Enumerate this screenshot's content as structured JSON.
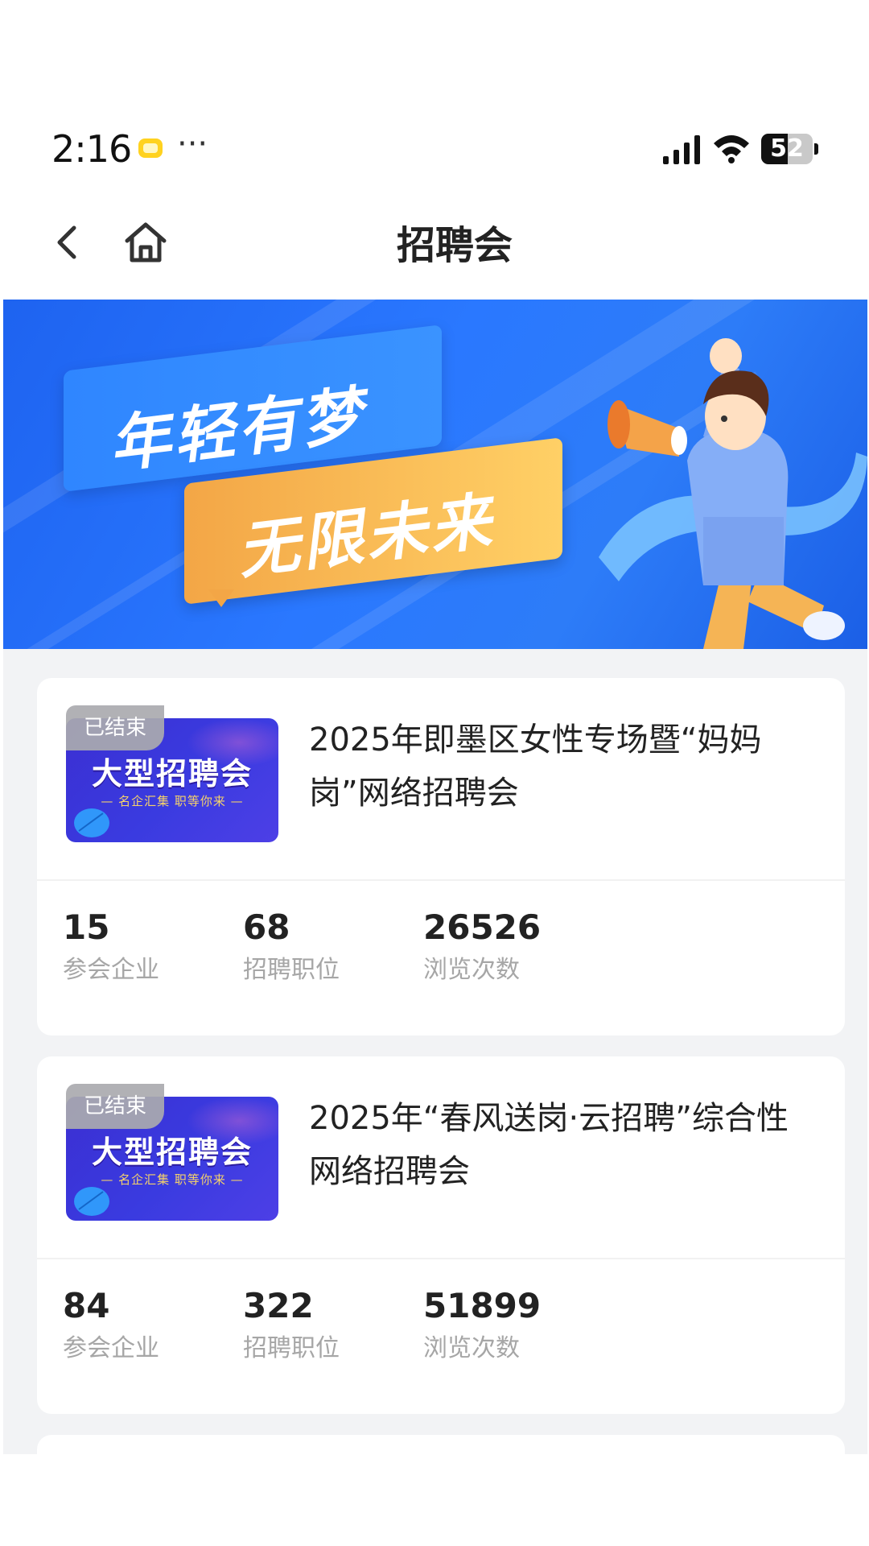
{
  "status_bar": {
    "time": "2:16",
    "dots": "···",
    "battery": "52",
    "battery_level": 0.52
  },
  "nav": {
    "title": "招聘会"
  },
  "banner": {
    "line1": "年轻有梦",
    "line2": "无限未来"
  },
  "fairs": [
    {
      "status": "已结束",
      "thumb_title": "大型招聘会",
      "thumb_subtitle": "— 名企汇集 职等你来 —",
      "title": "2025年即墨区女性专场暨“妈妈岗”网络招聘会",
      "stats": [
        {
          "value": "15",
          "label": "参会企业"
        },
        {
          "value": "68",
          "label": "招聘职位"
        },
        {
          "value": "26526",
          "label": "浏览次数"
        }
      ]
    },
    {
      "status": "已结束",
      "thumb_title": "大型招聘会",
      "thumb_subtitle": "— 名企汇集 职等你来 —",
      "title": "2025年“春风送岗·云招聘”综合性网络招聘会",
      "stats": [
        {
          "value": "84",
          "label": "参会企业"
        },
        {
          "value": "322",
          "label": "招聘职位"
        },
        {
          "value": "51899",
          "label": "浏览次数"
        }
      ]
    }
  ]
}
